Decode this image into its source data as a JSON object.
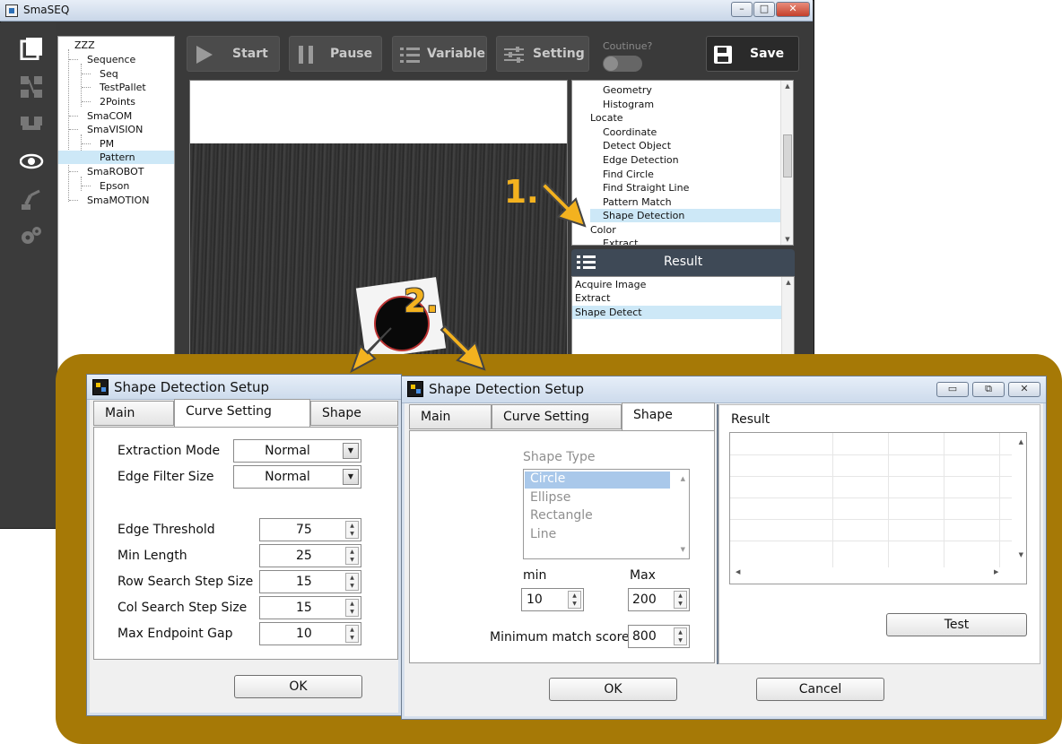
{
  "main_window": {
    "title": "SmaSEQ",
    "window_buttons": [
      "–",
      "□",
      "✕"
    ]
  },
  "sidebar_icons": [
    "new-page-icon",
    "flowchart-icon",
    "connection-icon",
    "eye-icon",
    "robot-arm-icon",
    "gears-icon"
  ],
  "project_tree": {
    "root": "ZZZ",
    "items": [
      {
        "label": "Sequence",
        "level": 1
      },
      {
        "label": "Seq",
        "level": 2
      },
      {
        "label": "TestPallet",
        "level": 2
      },
      {
        "label": "2Points",
        "level": 2
      },
      {
        "label": "SmaCOM",
        "level": 1
      },
      {
        "label": "SmaVISION",
        "level": 1
      },
      {
        "label": "PM",
        "level": 2
      },
      {
        "label": "Pattern",
        "level": 2,
        "selected": true
      },
      {
        "label": "SmaROBOT",
        "level": 1
      },
      {
        "label": "Epson",
        "level": 2
      },
      {
        "label": "SmaMOTION",
        "level": 1
      }
    ]
  },
  "toolbar": {
    "start": "Start",
    "pause": "Pause",
    "variable": "Variable",
    "setting": "Setting",
    "continue_label": "Coutinue?",
    "save": "Save"
  },
  "function_list": {
    "items": [
      {
        "label": "Geometry",
        "level": 2
      },
      {
        "label": "Histogram",
        "level": 2
      },
      {
        "label": "Locate",
        "level": 1
      },
      {
        "label": "Coordinate",
        "level": 2
      },
      {
        "label": "Detect Object",
        "level": 2
      },
      {
        "label": "Edge Detection",
        "level": 2
      },
      {
        "label": "Find Circle",
        "level": 2
      },
      {
        "label": "Find Straight Line",
        "level": 2
      },
      {
        "label": "Pattern Match",
        "level": 2
      },
      {
        "label": "Shape Detection",
        "level": 2,
        "selected": true
      },
      {
        "label": "Color",
        "level": 1
      },
      {
        "label": "Extract",
        "level": 2
      }
    ]
  },
  "result_panel": {
    "title": "Result",
    "items": [
      "Acquire Image",
      "Extract",
      "Shape Detect"
    ],
    "selected_index": 2
  },
  "callouts": {
    "step1": "1.",
    "step2": "2."
  },
  "dialog_curve": {
    "title": "Shape Detection Setup",
    "tabs": [
      "Main",
      "Curve Setting",
      "Shape"
    ],
    "active_tab": "Curve Setting",
    "fields": {
      "extraction_mode": {
        "label": "Extraction Mode",
        "value": "Normal"
      },
      "edge_filter_size": {
        "label": "Edge Filter Size",
        "value": "Normal"
      },
      "edge_threshold": {
        "label": "Edge Threshold",
        "value": "75"
      },
      "min_length": {
        "label": "Min Length",
        "value": "25"
      },
      "row_search_step": {
        "label": "Row Search Step Size",
        "value": "15"
      },
      "col_search_step": {
        "label": "Col Search Step Size",
        "value": "15"
      },
      "max_endpoint_gap": {
        "label": "Max Endpoint Gap",
        "value": "10"
      }
    },
    "ok": "OK"
  },
  "dialog_shape": {
    "title": "Shape Detection Setup",
    "tabs": [
      "Main",
      "Curve Setting",
      "Shape"
    ],
    "active_tab": "Shape",
    "shape_type_label": "Shape Type",
    "shape_types": [
      "Circle",
      "Ellipse",
      "Rectangle",
      "Line"
    ],
    "selected_shape": "Circle",
    "min_label": "min",
    "min_value": "10",
    "max_label": "Max",
    "max_value": "200",
    "min_match_label": "Minimum match score",
    "min_match_value": "800",
    "result_label": "Result",
    "test": "Test",
    "ok": "OK",
    "cancel": "Cancel",
    "window_buttons": [
      "▭",
      "⧉",
      "✕"
    ]
  },
  "colors": {
    "gold_panel": "#a67906",
    "callout_gold": "#f3b21f",
    "selection": "#cde8f7",
    "dark_bg": "#3a3a3a"
  }
}
